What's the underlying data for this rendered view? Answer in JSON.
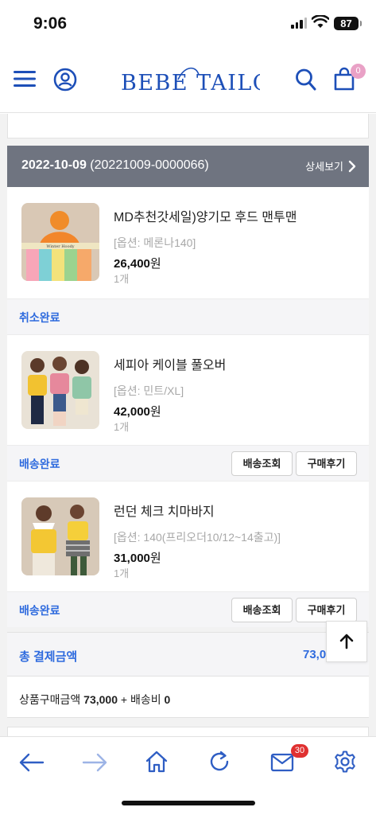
{
  "status_bar": {
    "time": "9:06",
    "battery": "87"
  },
  "header": {
    "logo": "BEBE TAILOR",
    "cart_count": "0"
  },
  "order": {
    "date": "2022-10-09",
    "order_no": "(20221009-0000066)",
    "detail_link": "상세보기"
  },
  "items": [
    {
      "name": "MD추천갓세일)양기모 후드 맨투맨",
      "option": "[옵션: 메론나140]",
      "price": "26,400",
      "price_unit": "원",
      "qty": "1개",
      "status": "취소완료",
      "thumb_caption": "Winter Hoody"
    },
    {
      "name": "세피아 케이블 풀오버",
      "option": "[옵션: 민트/XL]",
      "price": "42,000",
      "price_unit": "원",
      "qty": "1개",
      "status": "배송완료"
    },
    {
      "name": "런던 체크 치마바지",
      "option": "[옵션: 140(프리오더10/12~14출고)]",
      "price": "31,000",
      "price_unit": "원",
      "qty": "1개",
      "status": "배송완료"
    }
  ],
  "buttons": {
    "track": "배송조회",
    "review": "구매후기"
  },
  "summary": {
    "total_label": "총 결제금액",
    "total_value": "73,0",
    "goods_label": "상품구매금액",
    "goods_value": "73,000",
    "plus": "+",
    "shipping_label": "배송비",
    "shipping_value": "0"
  },
  "bottom_bar": {
    "mail_count": "30"
  },
  "colors": {
    "accent": "#2f6bde",
    "header_bar": "#6f7480",
    "logo": "#1d4fb8",
    "cart_badge": "#e9a1c6",
    "mail_badge": "#e03131"
  }
}
